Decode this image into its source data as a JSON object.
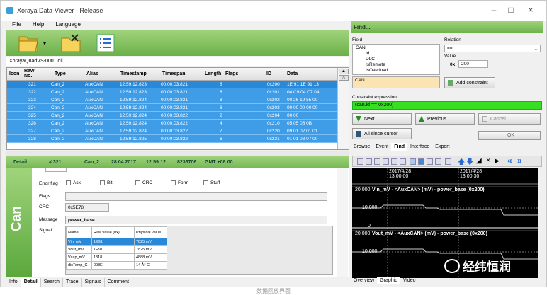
{
  "window": {
    "title": "Xoraya Data-Viewer - Release"
  },
  "menu": [
    "File",
    "Help",
    "Language"
  ],
  "file_tab": "XorayaQuadVS-0001.dli",
  "grid": {
    "headers": [
      "Icon",
      "Raw\nNo.",
      "Type",
      "Alias",
      "Timestamp",
      "Timespan",
      "Length",
      "Flags",
      "ID",
      "Data"
    ],
    "rows": [
      [
        "321",
        "Can_2",
        "AuxCAN",
        "12:59:12.823",
        "00:00:03.821",
        "8",
        "",
        "0x200",
        "1E 91 1E 91 13"
      ],
      [
        "322",
        "Can_2",
        "AuxCAN",
        "12:59:12.823",
        "00:00:03.821",
        "8",
        "",
        "0x201",
        "04 C9 04 C7 04"
      ],
      [
        "323",
        "Can_2",
        "AuxCAN",
        "12:59:12.824",
        "00:00:03.821",
        "8",
        "",
        "0x202",
        "00 26 19 55 00"
      ],
      [
        "324",
        "Can_2",
        "AuxCAN",
        "12:59:12.824",
        "00:00:03.821",
        "8",
        "",
        "0x203",
        "00 00 00 00 00"
      ],
      [
        "325",
        "Can_2",
        "AuxCAN",
        "12:59:12.824",
        "00:00:03.822",
        "2",
        "",
        "0x204",
        "00 00"
      ],
      [
        "326",
        "Can_2",
        "AuxCAN",
        "12:59:12.824",
        "00:00:03.822",
        "4",
        "",
        "0x210",
        "05 05 05 0B"
      ],
      [
        "327",
        "Can_2",
        "AuxCAN",
        "12:59:12.824",
        "00:00:03.822",
        "7",
        "",
        "0x220",
        "09 01 02 01 01"
      ],
      [
        "328",
        "Can_2",
        "AuxCAN",
        "12:59:12.825",
        "00:00:03.822",
        "6",
        "",
        "0x221",
        "01 01 08 07 00"
      ]
    ]
  },
  "detail_header": {
    "label": "Detail",
    "number": "# 321",
    "type": "Can_2",
    "date": "28.04.2017",
    "time": "12:59:12",
    "ticks": "8236706",
    "tz": "GMT +08:00"
  },
  "detail": {
    "side_label": "Can",
    "error_flag_label": "Error flag",
    "checkboxes": [
      "Ack",
      "Bit",
      "CRC",
      "Form",
      "Stuff"
    ],
    "flags_label": "Flags",
    "crc_label": "CRC",
    "crc_value": "0x5E78",
    "message_label": "Message",
    "message_value": "power_base",
    "signal_label": "Signal",
    "signal_headers": [
      "Name",
      "Raw value (0x)",
      "Physical value"
    ],
    "signals": [
      [
        "Vin_mV",
        "1E91",
        "7825 mV"
      ],
      [
        "Vout_mV",
        "1E91",
        "7825 mV"
      ],
      [
        "Vcap_mV",
        "1318",
        "4888 mV"
      ],
      [
        "disTemp_C",
        "008E",
        "14 Å° C"
      ]
    ]
  },
  "bottom_tabs": [
    "Info",
    "Detail",
    "Search",
    "Trace",
    "Signals",
    "Comment"
  ],
  "find": {
    "header": "Find...",
    "field_label": "Field",
    "relation_label": "Relation",
    "relation_value": "==",
    "value_label": "Value",
    "value_prefix": "0x",
    "value_value": "200",
    "tree": [
      "CAN",
      "Id",
      "DLC",
      "IsRemote",
      "IsOverload"
    ],
    "selected_field": "CAN",
    "add_constraint": "Add constraint",
    "constraint_label": "Constraint expression",
    "constraint_value": "(can.id == 0x200)",
    "next": "Next",
    "previous": "Previous",
    "cancel": "Cancel",
    "all_since_cursor": "All since cursor",
    "ok": "OK"
  },
  "right_tabs": [
    "Browse",
    "Event",
    "Find",
    "Interface",
    "Export"
  ],
  "plot": {
    "dates": [
      "2017/4/28\n13:00:00",
      "2017/4/28\n13:00:30"
    ],
    "signal1": "Vin_mV - <AuxCAN> (mV) - power_base (0x200)",
    "signal2": "Vout_mV - <AuxCAN> (mV) - power_base (0x200)",
    "ticks": [
      "20,000",
      "10,000",
      "0",
      "20,000",
      "10,000"
    ]
  },
  "right_bottom_tabs": [
    "Overview",
    "Graphic",
    "Video"
  ],
  "watermark": "经纬恒润",
  "caption": "数据回放界面",
  "colors": {
    "accent_green": "#7cc059",
    "selection_blue": "#3f9de8",
    "constraint_green": "#36e020"
  }
}
